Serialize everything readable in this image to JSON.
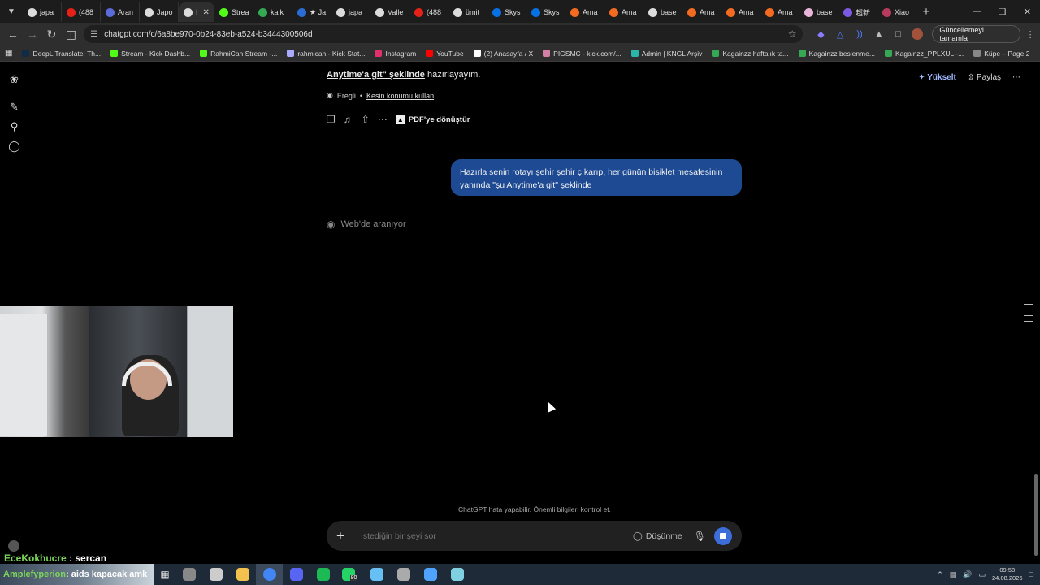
{
  "browser": {
    "tabs": [
      {
        "label": "japa",
        "color": "#dcdcdc"
      },
      {
        "label": "(488",
        "color": "#e62117"
      },
      {
        "label": "Aran",
        "color": "#5b6bd9"
      },
      {
        "label": "Japo",
        "color": "#dcdcdc"
      },
      {
        "label": "I",
        "color": "#dcdcdc",
        "active": true
      },
      {
        "label": "Strea",
        "color": "#53fc18"
      },
      {
        "label": "kalk",
        "color": "#34a853"
      },
      {
        "label": "★ Ja",
        "color": "#2b6cd4"
      },
      {
        "label": "japa",
        "color": "#dcdcdc"
      },
      {
        "label": "Valle",
        "color": "#dcdcdc"
      },
      {
        "label": "(488",
        "color": "#e62117"
      },
      {
        "label": "ümit",
        "color": "#dcdcdc"
      },
      {
        "label": "Skys",
        "color": "#0770e3"
      },
      {
        "label": "Skys",
        "color": "#0770e3"
      },
      {
        "label": "Ama",
        "color": "#f26b21"
      },
      {
        "label": "Ama",
        "color": "#f26b21"
      },
      {
        "label": "base",
        "color": "#dcdcdc"
      },
      {
        "label": "Ama",
        "color": "#f26b21"
      },
      {
        "label": "Ama",
        "color": "#f26b21"
      },
      {
        "label": "Ama",
        "color": "#f26b21"
      },
      {
        "label": "base",
        "color": "#e8b4d8"
      },
      {
        "label": "超新",
        "color": "#7a5ae0"
      },
      {
        "label": "Xiao",
        "color": "#b83b5e"
      }
    ],
    "url": "chatgpt.com/c/6a8be970-0b24-83eb-a524-b3444300506d",
    "update_label": "Güncellemeyi tamamla",
    "bookmarks": [
      {
        "label": "DeepL Translate: Th...",
        "color": "#0f2b46"
      },
      {
        "label": "Stream - Kick Dashb...",
        "color": "#53fc18"
      },
      {
        "label": "RahmiCan Stream -...",
        "color": "#53fc18"
      },
      {
        "label": "rahmican - Kick Stat...",
        "color": "#aaaaff"
      },
      {
        "label": "Instagram",
        "color": "#e1306c"
      },
      {
        "label": "YouTube",
        "color": "#ff0000"
      },
      {
        "label": "(2) Anasayfa / X",
        "color": "#ffffff"
      },
      {
        "label": "PIGSMC - kick.com/...",
        "color": "#d47fa6"
      },
      {
        "label": "Admin | KNGL Arşiv",
        "color": "#2ab7a9"
      },
      {
        "label": "Kagainzz haftalık ta...",
        "color": "#34a853"
      },
      {
        "label": "Kagainzz  beslenme...",
        "color": "#34a853"
      },
      {
        "label": "Kagainzz_PPLXUL -...",
        "color": "#34a853"
      },
      {
        "label": "Küpe – Page 2",
        "color": "#888888"
      }
    ]
  },
  "chat": {
    "prev_message_tail_bold": "Anytime'a git\" şeklinde",
    "prev_message_tail_rest": " hazırlayayım.",
    "location_city": "Eregli",
    "location_sep": "•",
    "location_link": "Kesin konumu kullan",
    "pdf_button": "PDF'ye dönüştür",
    "user_message": "Hazırla senin rotayı şehir şehir çıkarıp, her günün bisiklet mesafesinin yanında \"şu Anytime'a git\" şeklinde",
    "status": "Web'de aranıyor",
    "upgrade": "Yükselt",
    "share": "Paylaş",
    "disclaimer": "ChatGPT hata yapabilir. Önemli bilgileri kontrol et.",
    "composer_placeholder": "İstediğin bir şeyi sor",
    "think_label": "Düşünme"
  },
  "overlay": {
    "chat_user": "EceKokhucre",
    "chat_text": " : sercan",
    "taskbar_user": "Amplefyperion",
    "taskbar_text": " : aids kapacak amk"
  },
  "taskbar": {
    "time": "09:58",
    "date": "24.08.2026",
    "icons": [
      "#888888",
      "#cccccc",
      "#f2c14e",
      "#4285f4",
      "#5865f2",
      "#1db954",
      "#25d366",
      "#66c0f4",
      "#aaaaaa",
      "#4fa3ff",
      "#7fd0e0"
    ],
    "badge": "80"
  }
}
